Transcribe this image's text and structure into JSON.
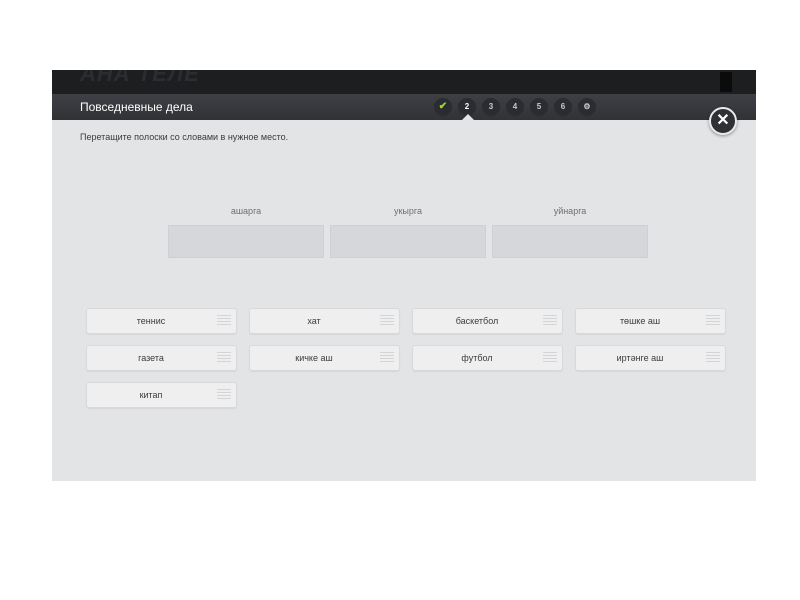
{
  "app": {
    "brand": "АНА ТЕЛЕ"
  },
  "header": {
    "title": "Повседневные дела"
  },
  "steps": [
    {
      "label": "✔",
      "state": "done"
    },
    {
      "label": "2",
      "state": "active"
    },
    {
      "label": "3",
      "state": "pending"
    },
    {
      "label": "4",
      "state": "pending"
    },
    {
      "label": "5",
      "state": "pending"
    },
    {
      "label": "6",
      "state": "pending"
    },
    {
      "label": "⚙",
      "state": "pending"
    }
  ],
  "close": {
    "label": "✕"
  },
  "instruction": "Перетащите полоски со словами в нужное место.",
  "targets": [
    "ашарга",
    "укырга",
    "уйнарга"
  ],
  "words": [
    "теннис",
    "хат",
    "баскетбол",
    "төшке аш",
    "газета",
    "кичке аш",
    "футбол",
    "иртәнге аш",
    "китап"
  ],
  "colors": {
    "accent_done": "#9fd63a",
    "header": "#35363a",
    "panel": "#e3e4e6"
  }
}
